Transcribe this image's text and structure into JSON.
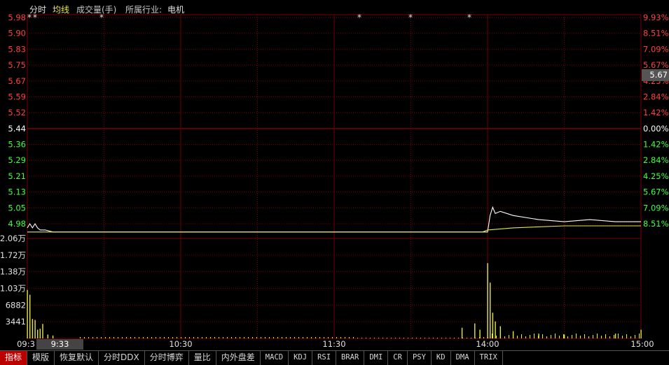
{
  "header": {
    "mode_label": "分时",
    "avg_label": "均线",
    "volume_label": "成交量(手)",
    "industry_label": "所属行业:",
    "industry_value": "电机"
  },
  "colors": {
    "up": "#ff4040",
    "down": "#40ff40",
    "neutral": "#ffffff",
    "price_line": "#ffffff",
    "avg_line": "#e8e840",
    "volume_bar": "#e8e840",
    "grid": "#7a0000"
  },
  "price_axis": {
    "left_labels": [
      "5.98",
      "5.90",
      "5.83",
      "5.75",
      "5.67",
      "5.59",
      "5.52",
      "5.44",
      "5.36",
      "5.29",
      "5.21",
      "5.13",
      "5.05",
      "4.98"
    ],
    "right_labels": [
      "9.93%",
      "8.51%",
      "7.09%",
      "5.67%",
      "4.25%",
      "2.84%",
      "1.42%",
      "0.00%",
      "1.42%",
      "2.84%",
      "4.25%",
      "5.67%",
      "7.09%",
      "8.51%"
    ],
    "prev_close": 5.44,
    "current_price_badge": "5.67"
  },
  "volume_axis": {
    "labels": [
      "2.06万",
      "1.72万",
      "1.38万",
      "1.03万",
      "6882",
      "3441"
    ]
  },
  "time_axis": {
    "labels": [
      "09:3",
      "10:30",
      "11:30",
      "14:00",
      "15:00"
    ],
    "hover_time": "9:33"
  },
  "event_markers": [
    "*",
    "*",
    "*",
    "*",
    "*",
    "*"
  ],
  "chart_data": {
    "type": "line",
    "x_range": [
      "09:30",
      "15:00"
    ],
    "ylim": [
      4.98,
      5.98
    ],
    "series": [
      {
        "name": "分时",
        "x": [
          "09:30",
          "09:31",
          "09:32",
          "09:33",
          "09:34",
          "09:35",
          "09:37",
          "09:40",
          "10:00",
          "11:00",
          "11:30",
          "13:00",
          "13:58",
          "14:00",
          "14:01",
          "14:02",
          "14:03",
          "14:05",
          "14:10",
          "14:20",
          "14:30",
          "14:40",
          "14:50",
          "15:00"
        ],
        "values": [
          4.96,
          4.98,
          4.96,
          4.98,
          4.96,
          4.95,
          4.95,
          4.94,
          4.94,
          4.94,
          4.94,
          4.94,
          4.94,
          4.94,
          5.02,
          5.06,
          5.03,
          5.04,
          5.02,
          5.0,
          4.99,
          5.0,
          4.99,
          4.99
        ]
      },
      {
        "name": "均线",
        "x": [
          "09:30",
          "09:35",
          "10:30",
          "11:30",
          "13:58",
          "14:00",
          "14:10",
          "14:30",
          "15:00"
        ],
        "values": [
          4.94,
          4.94,
          4.94,
          4.94,
          4.94,
          4.95,
          4.96,
          4.97,
          4.97
        ]
      }
    ],
    "volume": {
      "x": [
        "09:30",
        "09:31",
        "09:32",
        "09:33",
        "09:34",
        "09:35",
        "09:36",
        "09:38",
        "09:40",
        "13:50",
        "13:55",
        "13:57",
        "14:00",
        "14:01",
        "14:02",
        "14:03",
        "14:05",
        "14:10",
        "14:20",
        "14:30",
        "14:50",
        "15:00"
      ],
      "values": [
        10000,
        9000,
        4000,
        3800,
        1800,
        2000,
        3000,
        800,
        600,
        2200,
        3100,
        1800,
        15500,
        11500,
        5300,
        3500,
        2500,
        1500,
        1000,
        800,
        1000,
        1800
      ]
    }
  },
  "tabs": [
    {
      "label": "指标",
      "active": true,
      "mono": false
    },
    {
      "label": "模版",
      "active": false,
      "mono": false
    },
    {
      "label": "恢复默认",
      "active": false,
      "mono": false
    },
    {
      "label": "分时DDX",
      "active": false,
      "mono": false
    },
    {
      "label": "分时博弈",
      "active": false,
      "mono": false
    },
    {
      "label": "量比",
      "active": false,
      "mono": false
    },
    {
      "label": "内外盘差",
      "active": false,
      "mono": false
    },
    {
      "label": "MACD",
      "active": false,
      "mono": true
    },
    {
      "label": "KDJ",
      "active": false,
      "mono": true
    },
    {
      "label": "RSI",
      "active": false,
      "mono": true
    },
    {
      "label": "BRAR",
      "active": false,
      "mono": true
    },
    {
      "label": "DMI",
      "active": false,
      "mono": true
    },
    {
      "label": "CR",
      "active": false,
      "mono": true
    },
    {
      "label": "PSY",
      "active": false,
      "mono": true
    },
    {
      "label": "KD",
      "active": false,
      "mono": true
    },
    {
      "label": "DMA",
      "active": false,
      "mono": true
    },
    {
      "label": "TRIX",
      "active": false,
      "mono": true
    }
  ]
}
